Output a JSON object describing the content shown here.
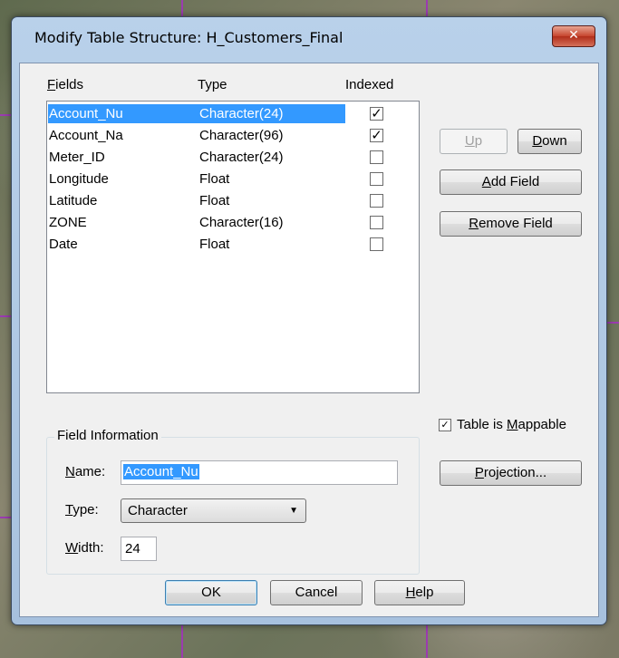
{
  "window": {
    "title": "Modify Table Structure: H_Customers_Final",
    "close": "✕"
  },
  "columns": {
    "fields": "Fields",
    "type": "Type",
    "indexed": "Indexed"
  },
  "rows": [
    {
      "name": "Account_Nu",
      "type": "Character(24)",
      "indexed": true,
      "selected": true
    },
    {
      "name": "Account_Na",
      "type": "Character(96)",
      "indexed": true,
      "selected": false
    },
    {
      "name": "Meter_ID",
      "type": "Character(24)",
      "indexed": false,
      "selected": false
    },
    {
      "name": "Longitude",
      "type": "Float",
      "indexed": false,
      "selected": false
    },
    {
      "name": "Latitude",
      "type": "Float",
      "indexed": false,
      "selected": false
    },
    {
      "name": "ZONE",
      "type": "Character(16)",
      "indexed": false,
      "selected": false
    },
    {
      "name": "Date",
      "type": "Float",
      "indexed": false,
      "selected": false
    }
  ],
  "buttons": {
    "up": "Up",
    "down": "Down",
    "add_field": "Add Field",
    "remove_field": "Remove Field",
    "projection": "Projection...",
    "ok": "OK",
    "cancel": "Cancel",
    "help": "Help"
  },
  "field_info": {
    "group_label": "Field Information",
    "name_label": "Name:",
    "name_value": "Account_Nu",
    "type_label": "Type:",
    "type_value": "Character",
    "width_label": "Width:",
    "width_value": "24"
  },
  "mappable": {
    "label": "Table is Mappable",
    "checked": true
  },
  "check_glyph": "✓"
}
